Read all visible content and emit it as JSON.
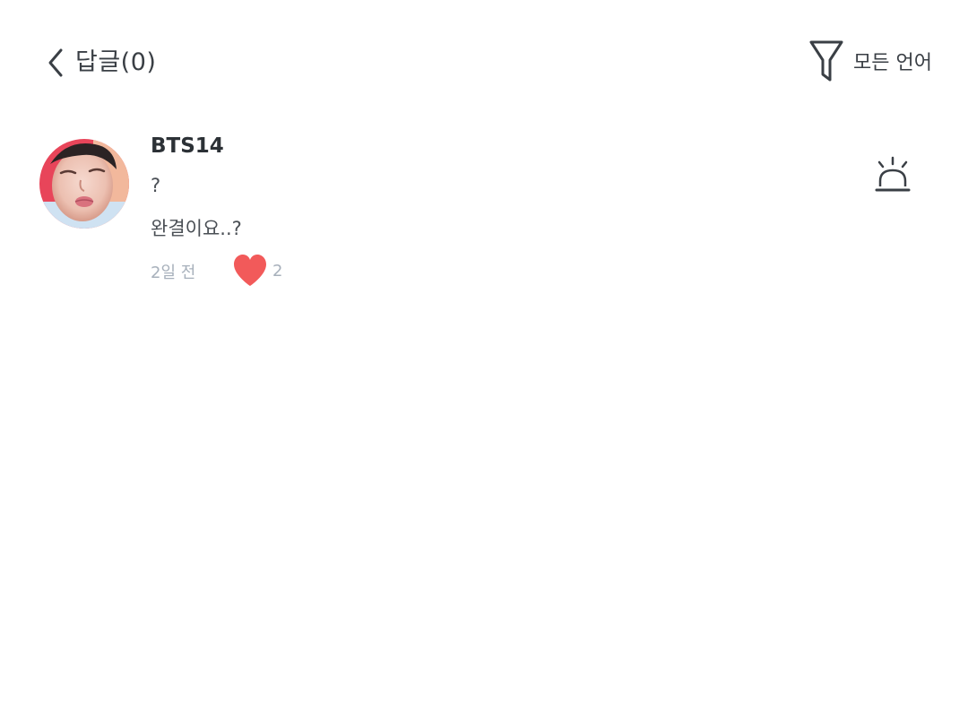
{
  "header": {
    "title": "답글(0)",
    "back_icon": "chevron-left-icon",
    "filter_icon": "funnel-icon",
    "filter_label": "모든 언어"
  },
  "comment": {
    "username": "BTS14",
    "lines": [
      "?",
      "완결이요..?"
    ],
    "time": "2일 전",
    "like_count": "2",
    "like_icon": "heart-icon",
    "report_icon": "siren-icon"
  },
  "colors": {
    "text": "#3a3f45",
    "muted": "#a7b0bb",
    "heart": "#f25a5a",
    "background": "#ffffff"
  }
}
